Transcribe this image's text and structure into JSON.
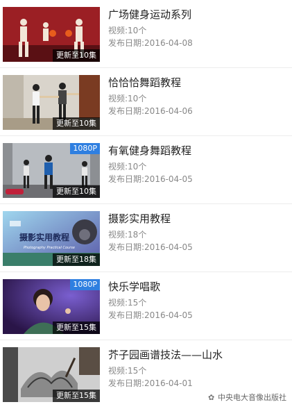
{
  "items": [
    {
      "title": "广场健身运动系列",
      "count_label": "视频:10个",
      "date_label": "发布日期:2016-04-08",
      "episode_badge": "更新至10集",
      "hd_badge": "",
      "thumb_icon": "dance-fitness-thumbnail"
    },
    {
      "title": "恰恰恰舞蹈教程",
      "count_label": "视频:10个",
      "date_label": "发布日期:2016-04-06",
      "episode_badge": "更新至10集",
      "hd_badge": "",
      "thumb_icon": "dance-couple-thumbnail"
    },
    {
      "title": "有氧健身舞蹈教程",
      "count_label": "视频:10个",
      "date_label": "发布日期:2016-04-05",
      "episode_badge": "更新至10集",
      "hd_badge": "1080P",
      "thumb_icon": "aerobics-thumbnail"
    },
    {
      "title": "摄影实用教程",
      "count_label": "视频:18个",
      "date_label": "发布日期:2016-04-05",
      "episode_badge": "更新至18集",
      "hd_badge": "",
      "thumb_icon": "photography-thumbnail"
    },
    {
      "title": "快乐学唱歌",
      "count_label": "视频:15个",
      "date_label": "发布日期:2016-04-05",
      "episode_badge": "更新至15集",
      "hd_badge": "1080P",
      "thumb_icon": "singing-thumbnail"
    },
    {
      "title": "芥子园画谱技法——山水",
      "count_label": "视频:15个",
      "date_label": "发布日期:2016-04-01",
      "episode_badge": "更新至15集",
      "hd_badge": "",
      "thumb_icon": "painting-thumbnail"
    }
  ],
  "thumb_text": {
    "photography_title": "摄影实用教程",
    "photography_subtitle": "Photography Practical Course"
  },
  "footer": {
    "publisher": "中央电大音像出版社",
    "icon": "wechat-icon"
  },
  "colors": {
    "hd_badge": "#2f7fe0",
    "title": "#222222",
    "meta": "#888888"
  }
}
